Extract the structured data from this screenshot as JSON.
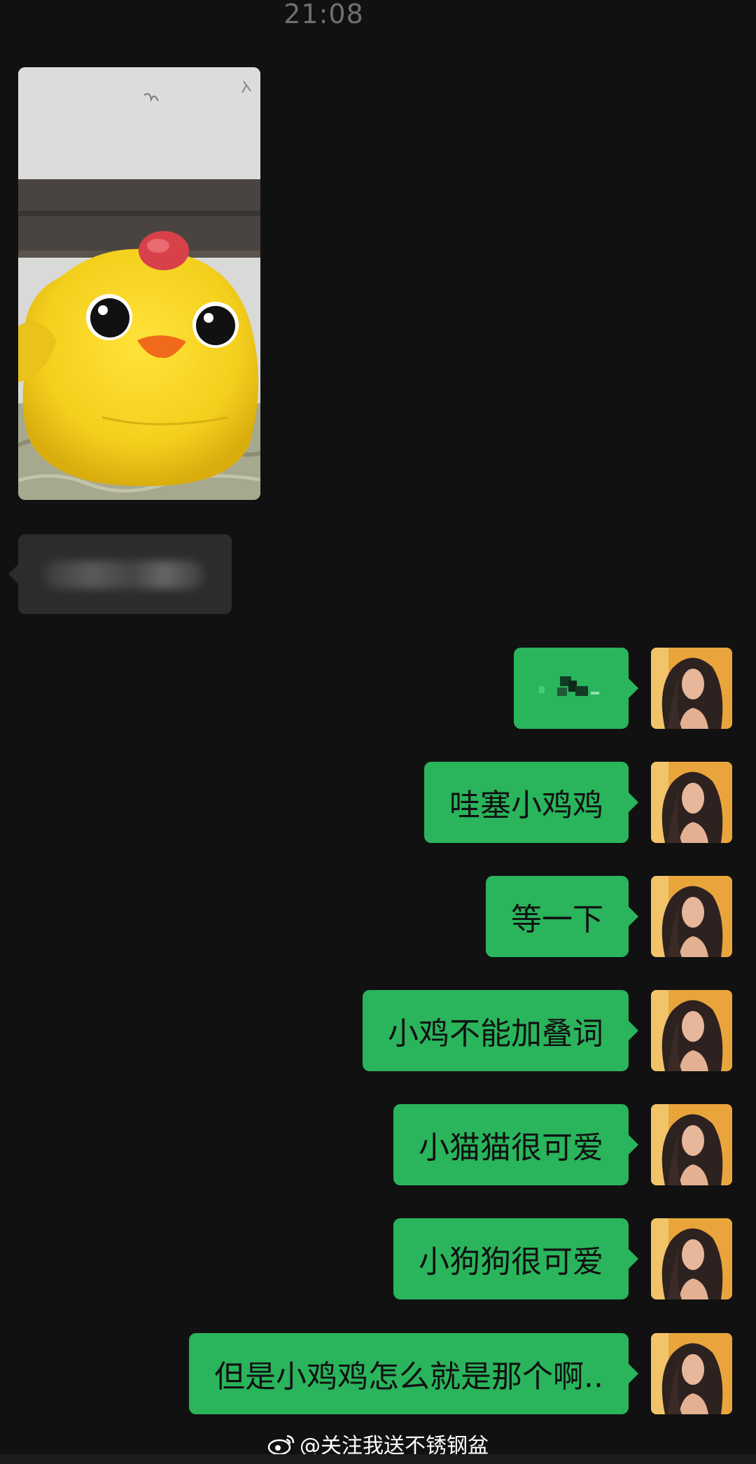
{
  "header": {
    "timestamp": "21:08"
  },
  "incoming": {
    "image_alt": "yellow-chick-plush-photo",
    "text_bubble": "blurred"
  },
  "outgoing_messages": [
    {
      "text": "",
      "censored": true
    },
    {
      "text": "哇塞小鸡鸡"
    },
    {
      "text": "等一下"
    },
    {
      "text": "小鸡不能加叠词"
    },
    {
      "text": "小猫猫很可爱"
    },
    {
      "text": "小狗狗很可爱"
    },
    {
      "text": "但是小鸡鸡怎么就是那个啊.."
    }
  ],
  "watermark": {
    "icon": "weibo-icon",
    "text": "@关注我送不锈钢盆"
  },
  "colors": {
    "background": "#111111",
    "outgoing_bubble": "#2ab45c",
    "incoming_bubble": "#2c2c2c",
    "timestamp": "#6f6f6f"
  }
}
